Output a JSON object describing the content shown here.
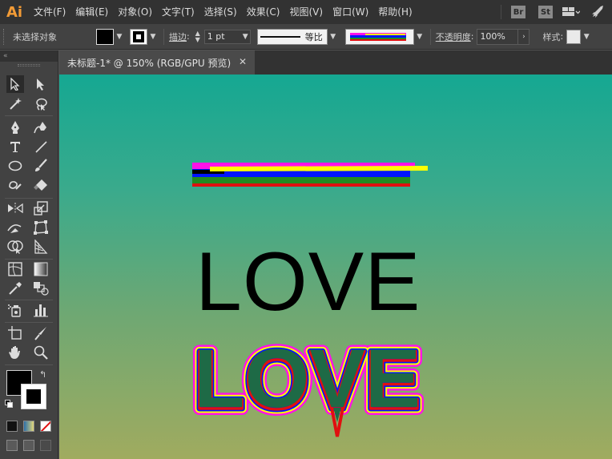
{
  "app": {
    "logo": "Ai"
  },
  "menu": [
    "文件(F)",
    "编辑(E)",
    "对象(O)",
    "文字(T)",
    "选择(S)",
    "效果(C)",
    "视图(V)",
    "窗口(W)",
    "帮助(H)"
  ],
  "menubar_right": {
    "bridge_label": "Br",
    "stock_label": "St"
  },
  "controlbar": {
    "selection_status": "未选择对象",
    "stroke_label": "描边",
    "stroke_weight": "1 pt",
    "profile_label": "等比",
    "opacity_label": "不透明度",
    "opacity_value": "100%",
    "style_label": "样式"
  },
  "panel": {
    "collapse_glyph": "«"
  },
  "document": {
    "tab_title": "未标题-1* @ 150% (RGB/GPU 预览)",
    "close_glyph": "✕"
  },
  "artwork": {
    "plain_text": "LOVE",
    "styled_text": "LOVE"
  },
  "colors": {
    "stripe_magenta": "#ff12e8",
    "stripe_yellow": "#ffff00",
    "stripe_blue": "#0014ff",
    "stripe_green": "#228b22",
    "stripe_red": "#e01010",
    "styled_green": "#1e6a46",
    "canvas_top": "#15a892",
    "canvas_bottom": "#a0ab5f"
  },
  "tools": [
    {
      "name": "selection-tool",
      "icon": "arrow-icon"
    },
    {
      "name": "direct-selection-tool",
      "icon": "white-arrow-icon"
    },
    {
      "name": "magic-wand-tool",
      "icon": "magic-wand-icon"
    },
    {
      "name": "lasso-tool",
      "icon": "lasso-icon"
    },
    {
      "name": "pen-tool",
      "icon": "pen-icon"
    },
    {
      "name": "curvature-tool",
      "icon": "curvature-icon"
    },
    {
      "name": "type-tool",
      "icon": "type-icon"
    },
    {
      "name": "line-tool",
      "icon": "line-icon"
    },
    {
      "name": "ellipse-tool",
      "icon": "ellipse-icon"
    },
    {
      "name": "paintbrush-tool",
      "icon": "brush-icon"
    },
    {
      "name": "shaper-tool",
      "icon": "shaper-icon"
    },
    {
      "name": "eraser-tool",
      "icon": "eraser-icon"
    },
    {
      "name": "reflect-tool",
      "icon": "reflect-icon"
    },
    {
      "name": "scale-tool",
      "icon": "scale-icon"
    },
    {
      "name": "width-tool",
      "icon": "width-icon"
    },
    {
      "name": "free-transform-tool",
      "icon": "free-transform-icon"
    },
    {
      "name": "shape-builder-tool",
      "icon": "shape-builder-icon"
    },
    {
      "name": "perspective-tool",
      "icon": "perspective-icon"
    },
    {
      "name": "mesh-tool",
      "icon": "mesh-icon"
    },
    {
      "name": "gradient-tool",
      "icon": "gradient-icon"
    },
    {
      "name": "eyedropper-tool",
      "icon": "eyedropper-icon"
    },
    {
      "name": "blend-tool",
      "icon": "blend-icon"
    },
    {
      "name": "symbol-sprayer-tool",
      "icon": "symbol-sprayer-icon"
    },
    {
      "name": "column-graph-tool",
      "icon": "graph-icon"
    },
    {
      "name": "artboard-tool",
      "icon": "artboard-icon"
    },
    {
      "name": "slice-tool",
      "icon": "slice-icon"
    },
    {
      "name": "hand-tool",
      "icon": "hand-icon"
    },
    {
      "name": "zoom-tool",
      "icon": "zoom-icon"
    }
  ]
}
